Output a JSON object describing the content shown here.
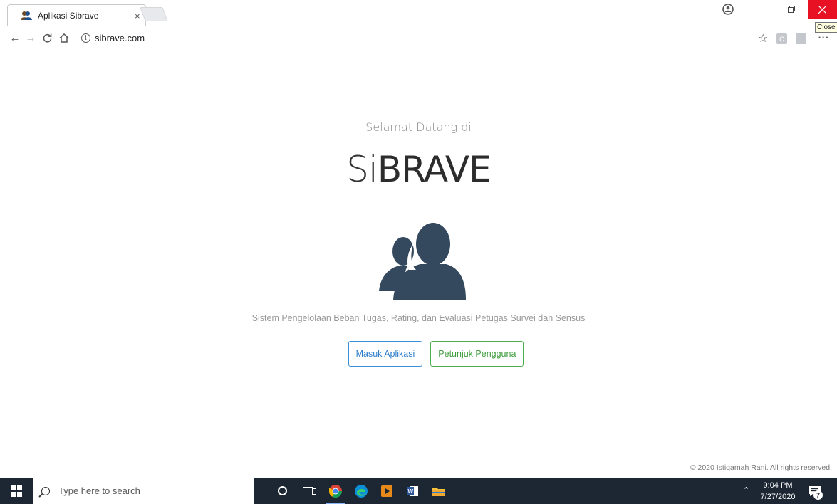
{
  "browser": {
    "tab_title": "Aplikasi Sibrave",
    "tab_close": "×",
    "url": "sibrave.com",
    "close_tooltip": "Close",
    "ext_c": "C",
    "ext_i": "I"
  },
  "page": {
    "welcome": "Selamat Datang di",
    "brand_light": "Si",
    "brand_bold": "BRAVE",
    "tagline": "Sistem Pengelolaan Beban Tugas, Rating, dan Evaluasi Petugas Survei dan Sensus",
    "login_button": "Masuk Aplikasi",
    "guide_button": "Petunjuk Pengguna",
    "footer": "© 2020 Istiqamah Rani. All rights reserved.",
    "icon_color": "#34495e"
  },
  "taskbar": {
    "search_placeholder": "Type here to search",
    "time": "9:04 PM",
    "date": "7/27/2020",
    "notification_count": "7"
  }
}
